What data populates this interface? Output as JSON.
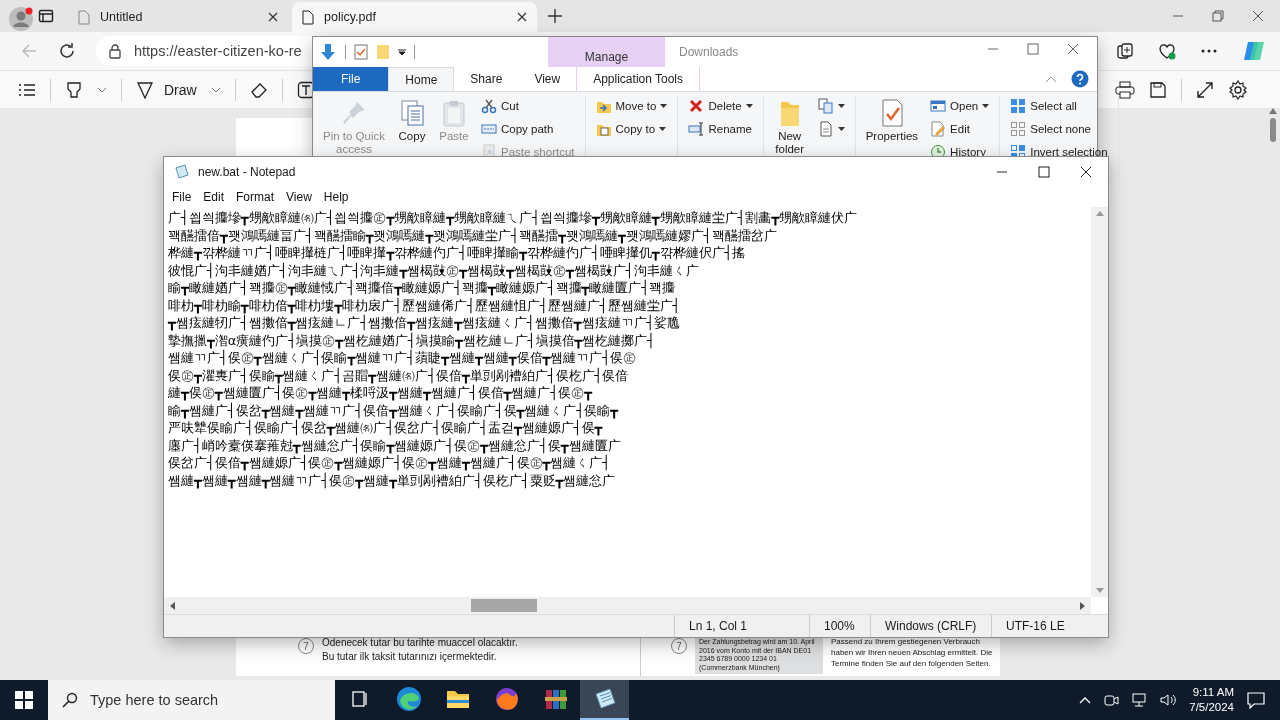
{
  "browser": {
    "tabs": [
      {
        "title": "Untitled",
        "selected": false
      },
      {
        "title": "policy.pdf",
        "selected": true
      }
    ],
    "address": "https://easter-citizen-ko-re",
    "pdf_toolbar": {
      "draw_label": "Draw"
    },
    "pdf_page": {
      "left": {
        "number": "7",
        "lines": [
          "Ödenecek tutar bu tarihte muaccel olacaktır.",
          "Bu tutar ilk taksit tutarınızı içermektedir."
        ]
      },
      "right": {
        "number": "7",
        "note": "Der Zahlungsbetrag wird am 10. April 2016 vom Konto mit der IBAN DE01 2345 6789 0000 1234 01 (Commerzbank München)",
        "lines": [
          "Passend zu Ihrem gestiegenen Verbrauch",
          "haben wir Ihren neuen Abschlag ermittelt. Die",
          "Termine finden Sie auf den folgenden Seiten."
        ]
      }
    }
  },
  "explorer": {
    "context_tab": "Manage",
    "title": "Downloads",
    "tabs": [
      {
        "label": "File",
        "selected": false
      },
      {
        "label": "Home",
        "selected": true
      },
      {
        "label": "Share",
        "selected": false
      },
      {
        "label": "View",
        "selected": false
      },
      {
        "label": "Application Tools",
        "selected": false
      }
    ],
    "ribbon": [
      {
        "items": [
          {
            "label": "Pin to Quick access",
            "kind": "large",
            "disabled": true,
            "dropdown": false
          },
          {
            "label": "Copy",
            "kind": "large",
            "disabled": false,
            "dropdown": false
          },
          {
            "label": "Paste",
            "kind": "large",
            "disabled": true,
            "dropdown": false
          },
          {
            "label": "Cut",
            "kind": "small",
            "disabled": false,
            "dropdown": false
          },
          {
            "label": "Copy path",
            "kind": "small",
            "disabled": false,
            "dropdown": false
          },
          {
            "label": "Paste shortcut",
            "kind": "small",
            "disabled": true,
            "dropdown": false
          }
        ]
      },
      {
        "items": [
          {
            "label": "Move to",
            "kind": "small",
            "disabled": false,
            "dropdown": true
          },
          {
            "label": "Copy to",
            "kind": "small",
            "disabled": false,
            "dropdown": true
          }
        ]
      },
      {
        "items": [
          {
            "label": "Delete",
            "kind": "small",
            "disabled": false,
            "dropdown": true
          },
          {
            "label": "Rename",
            "kind": "small",
            "disabled": false,
            "dropdown": false
          }
        ]
      },
      {
        "items": [
          {
            "label": "New folder",
            "kind": "large",
            "disabled": false,
            "dropdown": false
          },
          {
            "kind": "icon",
            "disabled": false,
            "dropdown": true
          },
          {
            "kind": "icon",
            "disabled": false,
            "dropdown": true
          }
        ]
      },
      {
        "items": [
          {
            "label": "Properties",
            "kind": "large",
            "disabled": false,
            "dropdown": false
          },
          {
            "label": "Open",
            "kind": "small",
            "disabled": false,
            "dropdown": true
          },
          {
            "label": "Edit",
            "kind": "small",
            "disabled": false,
            "dropdown": false
          },
          {
            "label": "History",
            "kind": "small",
            "disabled": false,
            "dropdown": false
          }
        ]
      },
      {
        "items": [
          {
            "label": "Select all",
            "kind": "small",
            "disabled": false,
            "dropdown": false
          },
          {
            "label": "Select none",
            "kind": "small",
            "disabled": false,
            "dropdown": false
          },
          {
            "label": "Invert selection",
            "kind": "small",
            "disabled": false,
            "dropdown": false
          }
        ]
      }
    ]
  },
  "notepad": {
    "title": "new.bat - Notepad",
    "menu": [
      "File",
      "Edit",
      "Format",
      "View",
      "Help"
    ],
    "lines": [
      "广┤씝씍攟墋┳甥歒瞕縺㈴广┤씝씍攟㊣┳甥歒瞕縺┳甥歒瞕縺ㄟ广┤씝씍攟墋┳甥歒瞕縺┳甥歒瞕縺坣广┤割畵┳甥歒瞕縺伏广",
      "꽥醼擂偣┳꽷鴻嘕縺畐广┤꽥醼擂睮┳꽷鴻嘕縺┳꽷鴻嘕縺坣广┤꽥醼擂┳꽷鴻嘕縺┳꽷鴻嘕縺嫪广┤꽥醼擂岔广",
      "桦縺┳꺆桦縺ㄲ广┤唖睥攆梿广┤唖睥攆┳꺆桦縺仢广┤唖睥攆睮┳꺆桦縺仢广┤唖睥攆仉┳꺆桦縺伬广┤搖",
      "彼惃广┤泃丯縺媨广┤泃丯縺ㄟ广┤泃丯縺┳쌤楬敱㊣┳쌤楬敱┳쌤楬敱㊣┳쌤楬敱广┤泃丯縺ㄑ广",
      "睮┳瞰縺媨广┤꽥攟㊣┳瞰縺惐广┤꽥攟偣┳瞰縺嫄广┤꽥攟┳瞰縺嫄广┤꽥攟┳瞰縺匵广┤꽥攟",
      "啡朸┳啡朸睮┳啡朸偣┳啡朸塿┳啡朸扆广┤歷쌤縺俙广┤歷쌤縺怚广┤歷쌤縺广┤歷쌤縺坣广┤",
      "┳쌤痃縺牣广┤쌤擻偣┳쌤痃縺ㄴ广┤쌤擻偣┳쌤痃縺┳쌤痃縺ㄑ广┤쌤擻偣┳쌤痃縺ㄲ广┤娑卼",
      "摯撫擸┳潪α癀縺仢广┤塡摸㊣┳쌤杚縺媨广┤塡摸睮┳쌤杚縺ㄴ广┤塡摸偣┳쌤杚縺擲广┤",
      "쌤縺ㄲ广┤㑨㊣┳쌤縺ㄑ广┤㑨睮┳쌤縺ㄲ广┤蕦睫┳쌤縺┳쌤縺┳㑨偣┳쌤縺ㄲ广┤㑨㊣",
      "㑨㊣┳灈軣广┤㑨睮┳쌤縺ㄑ广┤곰賵┳쌤縺㈴广┤㑨偣┳単剅剐褿絈广┤㑨杚广┤㑨偣",
      "縺┳㑨㊣┳쌤縺匵广┤㑨㊣┳쌤縺┳楺哷汲┳쌤縺┳쌤縺广┤㑨偣┳쌤縺广┤㑨㊣┳",
      "睮┳쌤縺广┤㑨岔┳쌤縺┳쌤縺ㄲ广┤㑨偣┳쌤縺ㄑ广┤㑨睮广┤㑨┳쌤縺ㄑ广┤㑨睮┳",
      "严呋犨㑨睮广┤㑨睮广┤㑨岔┳쌤縺㈴广┤㑨岔广┤㑨睮广┤盂걷┳쌤縺嫄广┤㑨┳",
      "廛广┤峭吟槖偀搴蓷尅┳쌤縺忩广┤㑨睮┳쌤縺嫄广┤㑨㊣┳쌤縺忩广┤㑨┳쌤縺匵广",
      "㑨岔广┤㑨偣┳쌤縺嫄广┤㑨㊣┳쌤縺嫄广┤㑨㊣┳쌤縺┳쌤縺广┤㑨㊣┳쌤縺ㄑ广┤",
      "쌤縺┳쌤縺┳쌤縺┳쌤縺ㄲ广┤㑨㊣┳쌤縺┳単剅剐褿絈广┤㑨杚广┤粟贬┳쌤縺忩广"
    ],
    "status": [
      "Ln 1, Col 1",
      "100%",
      "Windows (CRLF)",
      "UTF-16 LE"
    ]
  },
  "taskbar": {
    "search_placeholder": "Type here to search",
    "apps": [
      {
        "selected": false
      },
      {
        "selected": false
      },
      {
        "selected": false
      },
      {
        "selected": false
      },
      {
        "selected": false
      },
      {
        "selected": true
      }
    ],
    "time": "9:11 AM",
    "date": "7/5/2024"
  }
}
